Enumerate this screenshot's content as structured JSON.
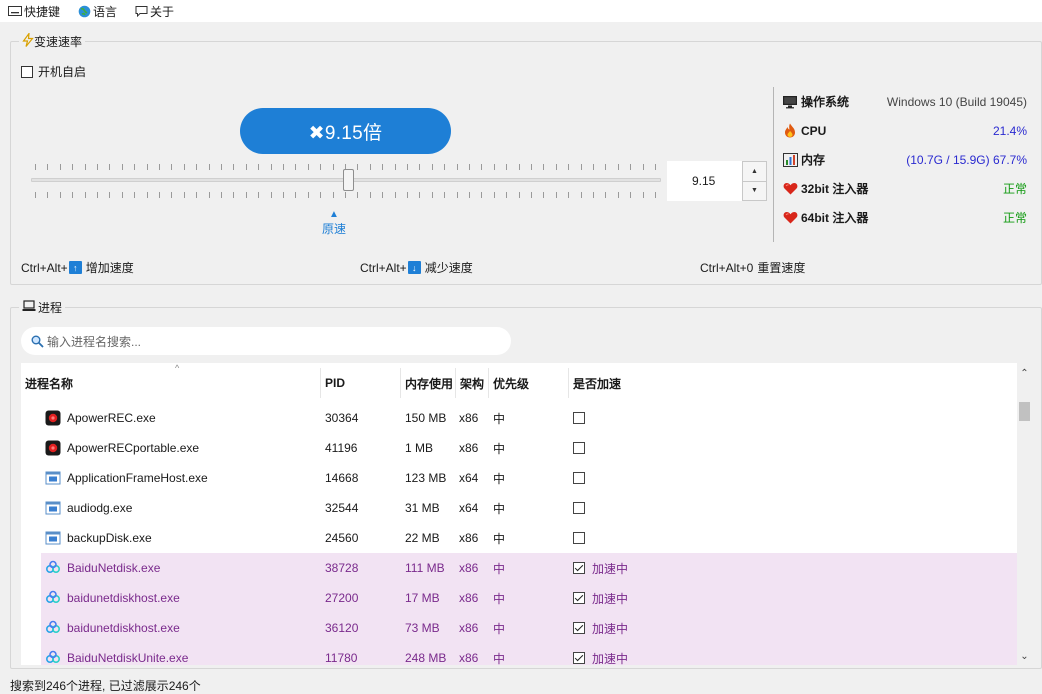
{
  "menu": [
    {
      "label": "快捷键",
      "icon": "keyboard-icon"
    },
    {
      "label": "语言",
      "icon": "globe-icon"
    },
    {
      "label": "关于",
      "icon": "about-icon"
    }
  ],
  "speed_group": {
    "title": "变速速率",
    "autostart_label": "开机自启",
    "autostart_checked": false,
    "speed_display": "✖9.15倍",
    "spin_value": "9.15",
    "origin_label": "原速",
    "hotkeys": [
      {
        "prefix": "Ctrl+Alt+",
        "key": "↑",
        "label": "增加速度"
      },
      {
        "prefix": "Ctrl+Alt+",
        "key": "↓",
        "label": "减少速度"
      },
      {
        "prefix": "Ctrl+Alt+0",
        "key": "",
        "label": "重置速度"
      }
    ]
  },
  "sysinfo": {
    "os_label": "操作系统",
    "os_value": "Windows 10 (Build 19045)",
    "cpu_label": "CPU",
    "cpu_value": "21.4%",
    "mem_label": "内存",
    "mem_value": "(10.7G / 15.9G) 67.7%",
    "inj32_label": "32bit 注入器",
    "inj32_value": "正常",
    "inj64_label": "64bit 注入器",
    "inj64_value": "正常"
  },
  "process_group": {
    "title": "进程",
    "search_placeholder": "输入进程名搜索...",
    "columns": [
      "进程名称",
      "PID",
      "内存使用",
      "架构",
      "优先级",
      "是否加速"
    ],
    "rows": [
      {
        "name": "ApowerREC.exe",
        "pid": "30364",
        "mem": "150 MB",
        "arch": "x86",
        "pri": "中",
        "accel": false,
        "accel_label": "",
        "icon": "apowerrec-icon"
      },
      {
        "name": "ApowerRECportable.exe",
        "pid": "41196",
        "mem": "1 MB",
        "arch": "x86",
        "pri": "中",
        "accel": false,
        "accel_label": "",
        "icon": "apowerrec-icon"
      },
      {
        "name": "ApplicationFrameHost.exe",
        "pid": "14668",
        "mem": "123 MB",
        "arch": "x64",
        "pri": "中",
        "accel": false,
        "accel_label": "",
        "icon": "window-app-icon"
      },
      {
        "name": "audiodg.exe",
        "pid": "32544",
        "mem": "31 MB",
        "arch": "x64",
        "pri": "中",
        "accel": false,
        "accel_label": "",
        "icon": "window-app-icon"
      },
      {
        "name": "backupDisk.exe",
        "pid": "24560",
        "mem": "22 MB",
        "arch": "x86",
        "pri": "中",
        "accel": false,
        "accel_label": "",
        "icon": "window-app-icon"
      },
      {
        "name": "BaiduNetdisk.exe",
        "pid": "38728",
        "mem": "111 MB",
        "arch": "x86",
        "pri": "中",
        "accel": true,
        "accel_label": "加速中",
        "icon": "baidu-netdisk-icon"
      },
      {
        "name": "baidunetdiskhost.exe",
        "pid": "27200",
        "mem": "17 MB",
        "arch": "x86",
        "pri": "中",
        "accel": true,
        "accel_label": "加速中",
        "icon": "baidu-netdisk-icon"
      },
      {
        "name": "baidunetdiskhost.exe",
        "pid": "36120",
        "mem": "73 MB",
        "arch": "x86",
        "pri": "中",
        "accel": true,
        "accel_label": "加速中",
        "icon": "baidu-netdisk-icon"
      },
      {
        "name": "BaiduNetdiskUnite.exe",
        "pid": "11780",
        "mem": "248 MB",
        "arch": "x86",
        "pri": "中",
        "accel": true,
        "accel_label": "加速中",
        "icon": "baidu-netdisk-icon"
      }
    ]
  },
  "status": "搜索到246个进程, 已过滤展示246个",
  "colors": {
    "accent": "#1e7fd6",
    "highlight_row": "#f2e3f3",
    "highlight_text": "#7a2a8c",
    "ok_green": "#119a11",
    "value_blue": "#2a2ad0"
  }
}
